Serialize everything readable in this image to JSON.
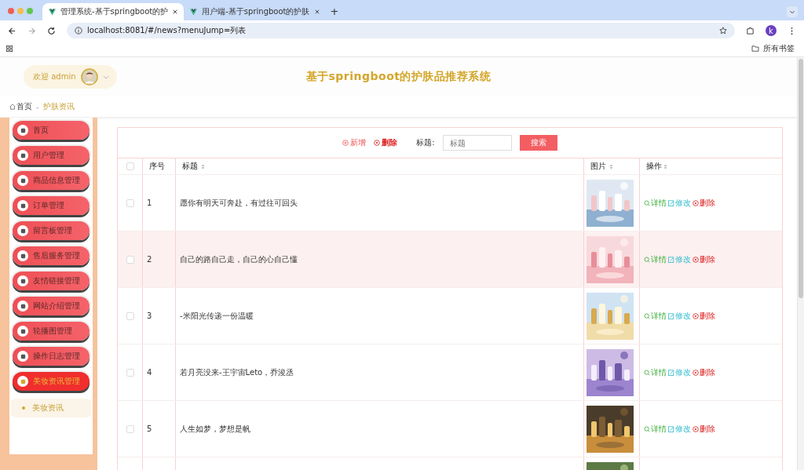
{
  "browser": {
    "tabs": [
      {
        "title": "管理系统-基于springboot的护",
        "selected": true
      },
      {
        "title": "用户端-基于springboot的护肤",
        "selected": false
      }
    ],
    "new_tab": "+",
    "url": "localhost:8081/#/news?menuJump=列表",
    "profile": "k",
    "bookmarks": "所有书签"
  },
  "header": {
    "welcome": "欢迎 admin",
    "title": "基于springboot的护肤品推荐系统"
  },
  "breadcrumb": [
    {
      "label": "首页"
    },
    {
      "label": "护肤资讯"
    }
  ],
  "breadcrumb_separator": "-",
  "sidebar": {
    "items": [
      {
        "label": "首页",
        "selected": false
      },
      {
        "label": "用户管理",
        "selected": false
      },
      {
        "label": "商品信息管理",
        "selected": false
      },
      {
        "label": "订单管理",
        "selected": false
      },
      {
        "label": "留言板管理",
        "selected": false
      },
      {
        "label": "售后服务管理",
        "selected": false
      },
      {
        "label": "友情链接管理",
        "selected": false
      },
      {
        "label": "网站介绍管理",
        "selected": false
      },
      {
        "label": "轮播图管理",
        "selected": false
      },
      {
        "label": "操作日志管理",
        "selected": false
      },
      {
        "label": "美妆资讯管理",
        "selected": true,
        "expanded": true,
        "children": [
          {
            "label": "美妆资讯"
          }
        ]
      }
    ]
  },
  "toolbar": {
    "add": "新增",
    "delete": "删除",
    "search_label": "标题:",
    "search_placeholder": "标题",
    "search_button": "搜索"
  },
  "table": {
    "columns": [
      "序号",
      "标题",
      "图片",
      "操作"
    ],
    "header_checked": false,
    "rows": [
      {
        "kind": "item",
        "index": "1",
        "title": "愿你有明天可奔赴，有过往可回头",
        "checked": false,
        "highlighted": false,
        "actions": [
          "详情",
          "修改",
          "删除"
        ]
      },
      {
        "kind": "item",
        "index": "2",
        "title": "自己的路自己走，自己的心自己懂",
        "checked": false,
        "highlighted": true,
        "actions": [
          "详情",
          "修改",
          "删除"
        ]
      },
      {
        "kind": "item",
        "index": "3",
        "title": "-米阳光传递一份温暖",
        "checked": false,
        "highlighted": false,
        "actions": [
          "详情",
          "修改",
          "删除"
        ]
      },
      {
        "kind": "item",
        "index": "4",
        "title": "若月亮没来-王宇宙Leto，乔浚丞",
        "checked": false,
        "highlighted": false,
        "actions": [
          "详情",
          "修改",
          "删除"
        ]
      },
      {
        "kind": "item",
        "index": "5",
        "title": "人生如梦，梦想是帆",
        "checked": false,
        "highlighted": false,
        "actions": [
          "详情",
          "修改",
          "删除"
        ]
      },
      {
        "kind": "picture",
        "highlighted": false
      }
    ]
  }
}
